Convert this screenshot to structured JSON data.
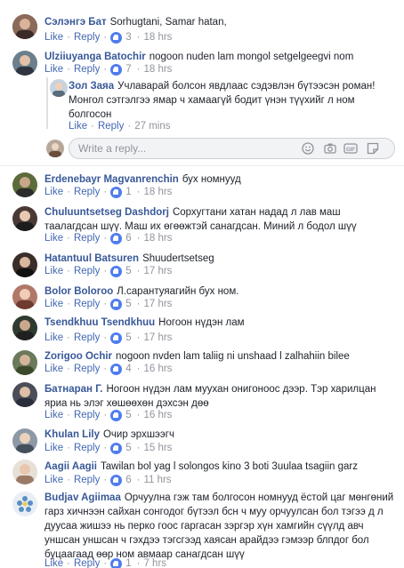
{
  "comments": [
    {
      "name": "Сэлэнгэ Бат",
      "text": "Sorhugtani, Samar hatan,",
      "like": "Like",
      "reply": "Reply",
      "count": "3",
      "time": "18 hrs"
    },
    {
      "name": "Ulziiuyanga Batochir",
      "text": "nogoon nuden lam mongol setgelgeegvi nom",
      "like": "Like",
      "reply": "Reply",
      "count": "7",
      "time": "18 hrs"
    },
    {
      "name": "Erdenebayr Magvanrenchin",
      "text": "бух номнууд",
      "like": "Like",
      "reply": "Reply",
      "count": "1",
      "time": "18 hrs"
    },
    {
      "name": "Chuluuntsetseg Dashdorj",
      "text": "Сорхугтани хатан надад л лав маш таалагдсан шүү. Маш их өгөөжтэй санагдсан. Миний л бодол шүү",
      "like": "Like",
      "reply": "Reply",
      "count": "6",
      "time": "18 hrs"
    },
    {
      "name": "Hatantuul Batsuren",
      "text": "Shuudertsetseg",
      "like": "Like",
      "reply": "Reply",
      "count": "5",
      "time": "17 hrs"
    },
    {
      "name": "Bolor Boloroo",
      "text": "Л.сарантуяагийн бух ном.",
      "like": "Like",
      "reply": "Reply",
      "count": "5",
      "time": "17 hrs"
    },
    {
      "name": "Tsendkhuu Tsendkhuu",
      "text": "Ногоон нүдэн лам",
      "like": "Like",
      "reply": "Reply",
      "count": "5",
      "time": "17 hrs"
    },
    {
      "name": "Zorigoo Ochir",
      "text": "nogoon nvden lam taliig ni unshaad l zalhahiin bilee",
      "like": "Like",
      "reply": "Reply",
      "count": "4",
      "time": "16 hrs"
    },
    {
      "name": "Батнаран Г.",
      "text": "Ногоон нүдэн лам муухан онигоноос дээр. Тэр харилцан яриа нь элэг хөшөөхөн дэхсэн дөө",
      "like": "Like",
      "reply": "Reply",
      "count": "5",
      "time": "16 hrs"
    },
    {
      "name": "Khulan Lily",
      "text": "Очир эрхшээгч",
      "like": "Like",
      "reply": "Reply",
      "count": "5",
      "time": "15 hrs"
    },
    {
      "name": "Aagii Aagii",
      "text": "Tawilan bol yag l solongos kino 3 boti 3uulaa tsagiin garz",
      "like": "Like",
      "reply": "Reply",
      "count": "6",
      "time": "11 hrs"
    },
    {
      "name": "Budjav Agiimaa",
      "text": "Орчуулна гэж там болгосон номнууд ёстой цаг мөнгөний гарз хичнээн сайхан сонгодог бүтээл бсн ч муу орчуулсан бол тэгээ д л дуусаа жишээ нь перко гоос гаргасан зэргэр хүн хамгийн сүүлд авч уншсан уншсан ч гэхдээ тэгсгээд хаясан арайдээ гэмээр блпдог бол буцаагаад өөр ном авмаар санагдсан шүү",
      "like": "Like",
      "reply": "Reply",
      "count": "1",
      "time": "7 hrs"
    }
  ],
  "reply": {
    "name": "Зол Заяа",
    "text": "Учлаварай болсон явдлаас сэдэвлэн бүтээсэн роман! Монгол сэтгэлгээ ямар ч хамаагүй бодит үнэн түүхийг л ном болгосон",
    "like": "Like",
    "reply": "Reply",
    "time": "27 mins"
  },
  "write_reply": {
    "placeholder": "Write a reply..."
  },
  "colors": {
    "name": "#385898",
    "link": "#4267b2",
    "meta": "#90949c",
    "like_badge": "#4e7cf0"
  }
}
